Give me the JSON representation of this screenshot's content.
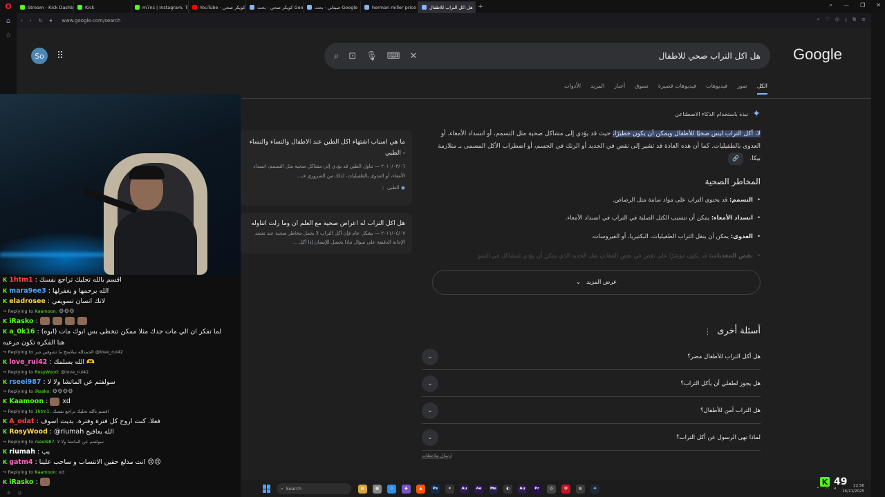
{
  "browser": {
    "tabs": [
      {
        "label": "Stream - Kick Dashboard",
        "color": "#53fc18",
        "active": false
      },
      {
        "label": "Kick",
        "color": "#53fc18",
        "active": false
      },
      {
        "label": "m7ns | Instagram, TikTok |",
        "color": "#53fc18",
        "active": false
      },
      {
        "label": "YouTube - كويكز صحي",
        "color": "#ff0000",
        "active": false
      },
      {
        "label": "كويكز صحي - بحث Google",
        "color": "#8ab4f8",
        "active": false
      },
      {
        "label": "صيدلي - بحث Google",
        "color": "#8ab4f8",
        "active": false
      },
      {
        "label": "herman miller price - Goo",
        "color": "#8ab4f8",
        "active": false
      },
      {
        "label": "هل اكل التراب للاطفال",
        "color": "#8ab4f8",
        "active": true
      }
    ],
    "new_tab": "+",
    "url": "www.google.com/search"
  },
  "google": {
    "avatar_initials": "So",
    "apps_icon": "⋮⋮",
    "query": "هل اكل التراب صحي للاطفال",
    "logo": "Google",
    "tabs": [
      "الكل",
      "صور",
      "فيديوهات",
      "فيديوهات قصيرة",
      "تسوق",
      "أخبار",
      "المزيد",
      "الأدوات"
    ],
    "ai_heading": "نبذة باستخدام الذكاء الاصطناعي",
    "ai_highlight": "لا، أكل التراب ليس صحيًا للأطفال ويمكن أن يكون خطيرًا،",
    "ai_body": " حيث قد يؤدي إلى مشاكل صحية مثل التسمم، أو انسداد الأمعاء، أو العدوى بالطفيليات. كما أن هذه العادة قد تشير إلى نقص في الحديد أو الزنك في الجسم، أو اضطراب الأكل المسمى بـ متلازمة بيكا.",
    "chip": "🔗",
    "risks_heading": "المخاطر الصحية",
    "risks": [
      {
        "title": "التسمم:",
        "text": "قد يحتوي التراب على مواد سامة مثل الرصاص."
      },
      {
        "title": "انسداد الأمعاء:",
        "text": "يمكن أن تتسبب الكتل الصلبة في التراب في انسداد الأمعاء."
      },
      {
        "title": "العدوى:",
        "text": "يمكن أن ينقل التراب الطفيليات، البكتيريا، أو الفيروسات."
      },
      {
        "title": "نقص المغذيات:",
        "text": "قد يكون مؤشرًا على نقص في بعض المعادن مثل الحديد الذي يمكن أن يؤدي لمشاكل في النمو"
      }
    ],
    "show_more": "عرض المزيد",
    "cards": [
      {
        "title": "ما هي اسباب اشتهاء اكل الطين عند الاطفال والنساء والنساء - الطبي",
        "snippet": "٢٠١٠/٠٣/٠٦ — تناول الطين قد يؤدي إلى مشاكل صحية مثل التسمم، انسداد الأمعاء، أو العدوى بالطفيليات، لذلك من الضروري ف...",
        "source": "الطبي"
      },
      {
        "title": "هل اكل التراب له اعراض صحية مع العلم ان وما زلت اتناوله",
        "snippet": "٢٠١١/٠٤/٠٧ — بشكل عام فإن أكل التراب لا يحمل مخاطر صحية عند تعتمد الإجابة الدقيقة على سؤال ماذا يحصل للإنسان إذا أكل ..."
      }
    ],
    "paa_heading": "أسئلة أخرى",
    "paa": [
      "هل أكل التراب للأطفال مضر؟",
      "هل يجوز لطفلي أن يأكل التراب؟",
      "هل التراب آمن للأطفال؟",
      "لماذا نهى الرسول عن أكل التراب؟"
    ],
    "feedback": "إرسال ملاحظات"
  },
  "chat": {
    "messages": [
      {
        "type": "msg",
        "user": "1htm1",
        "color": "#ff4444",
        "text": "اقسم بالله تحليك تراجع نفسك"
      },
      {
        "type": "msg",
        "user": "mara9ee3",
        "color": "#4fa3ff",
        "text": "الله يرحمها و يغفرلها"
      },
      {
        "type": "msg",
        "user": "eladrosee",
        "color": "#ffd54f",
        "text": "لانك انسان تسويفي"
      },
      {
        "type": "reply",
        "to": "Kaamoon",
        "text": "🐵🐵🐵"
      },
      {
        "type": "msg",
        "user": "iRasko",
        "color": "#53fc18",
        "text": "",
        "emotes": 4
      },
      {
        "type": "msg",
        "user": "a_0k16",
        "color": "#53fc18",
        "text": "لما تفكر ان الي مات جدك مثلا ممكن تتخطى بس ابوك مات (ابوه)"
      },
      {
        "type": "cont",
        "text": "هنا الفكره تكون مرعبه"
      },
      {
        "type": "reply",
        "to": "",
        "text": "الحمدلله سلامتج ما تشوفين شر @love_rui42"
      },
      {
        "type": "msg",
        "user": "love_rui42",
        "color": "#ff66c4",
        "text": "الله يسلمك 🫶"
      },
      {
        "type": "reply",
        "to": "RosyWood",
        "text": "@love_rui42"
      },
      {
        "type": "msg",
        "user": "rseei987",
        "color": "#4fa3ff",
        "text": "سولفتم عن الماتشا ولا لا"
      },
      {
        "type": "reply",
        "to": "iRasko",
        "text": "🐵🐵🐵🐵"
      },
      {
        "type": "msg",
        "user": "Kaamoon",
        "color": "#53fc18",
        "text": "xd",
        "emotes": 1
      },
      {
        "type": "reply",
        "to": "1htm1",
        "text": "اقسم بالله تحليك تراجع نفسك"
      },
      {
        "type": "msg",
        "user": "A_odat",
        "color": "#ff4444",
        "text": "فعلا. كنت اروح كل فترة وفترة. بديت اسوف"
      },
      {
        "type": "msg",
        "user": "RosyWood",
        "color": "#ffd54f",
        "text": "@riumah الله يعافيج"
      },
      {
        "type": "reply",
        "to": "rseei987",
        "text": "سولفتم عن الماتشا ولا لا"
      },
      {
        "type": "msg",
        "user": "riumah",
        "color": "#ffffff",
        "text": "يب"
      },
      {
        "type": "msg",
        "user": "gatm4",
        "color": "#ff66c4",
        "text": "انت مدلع حقين الانتساب و ساحب علينا 😢😢"
      },
      {
        "type": "reply",
        "to": "Kaamoon",
        "text": "xd"
      },
      {
        "type": "msg",
        "user": "iRasko",
        "color": "#53fc18",
        "text": "",
        "emotes": 1
      }
    ]
  },
  "taskbar": {
    "search": "Search",
    "apps": [
      {
        "label": "▤",
        "color": "#d9a441"
      },
      {
        "label": "▦",
        "color": "#888888"
      },
      {
        "label": "◇",
        "color": "#2f8ee5"
      },
      {
        "label": "◆",
        "color": "#7b55c7"
      },
      {
        "label": "▲",
        "color": "#ff5500"
      },
      {
        "label": "Ps",
        "color": "#0f2b4d"
      },
      {
        "label": "✦",
        "color": "#333333"
      },
      {
        "label": "Au",
        "color": "#2e1a4d"
      },
      {
        "label": "Ae",
        "color": "#2a1550"
      },
      {
        "label": "Me",
        "color": "#281b50"
      },
      {
        "label": "◐",
        "color": "#333333"
      },
      {
        "label": "Au",
        "color": "#2e1a4d"
      },
      {
        "label": "Pr",
        "color": "#2a0f4d"
      },
      {
        "label": "◎",
        "color": "#444444"
      },
      {
        "label": "O",
        "color": "#cc1122"
      },
      {
        "label": "◍",
        "color": "#3a3a3a"
      },
      {
        "label": "✈",
        "color": "#1d2a3a"
      }
    ],
    "time": "22:56",
    "date": "16/11/2025"
  },
  "kick": {
    "logo": "K",
    "viewers": "49"
  }
}
